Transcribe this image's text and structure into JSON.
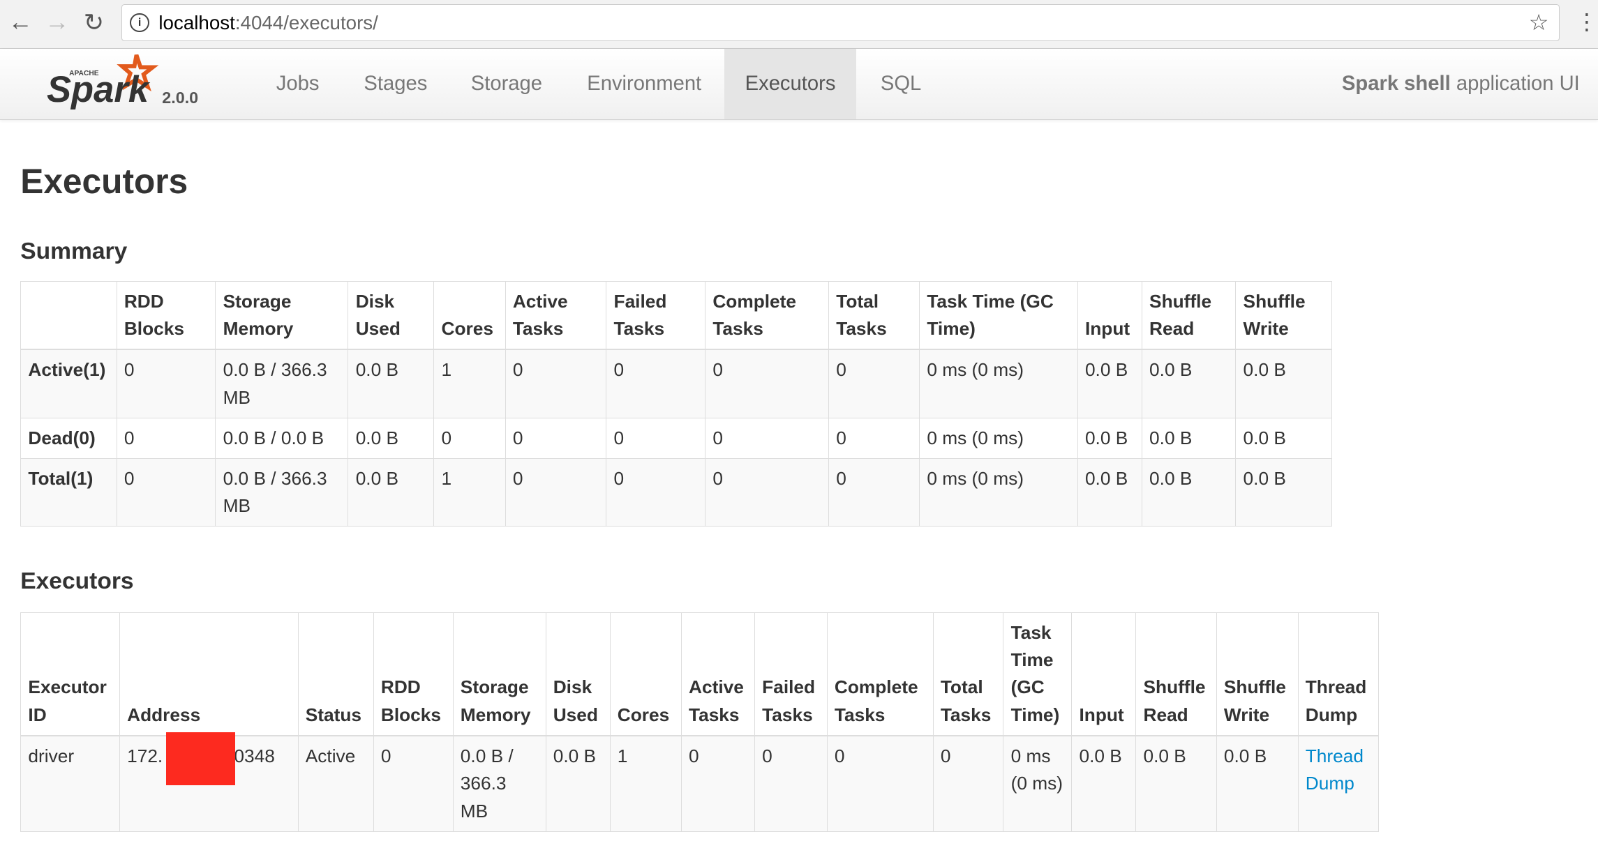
{
  "browser": {
    "url_host": "localhost",
    "url_rest": ":4044/executors/"
  },
  "nav": {
    "version": "2.0.0",
    "tabs": [
      "Jobs",
      "Stages",
      "Storage",
      "Environment",
      "Executors",
      "SQL"
    ],
    "active_tab": "Executors",
    "app_name_bold": "Spark shell",
    "app_name_rest": " application UI",
    "logo_text": "Spark",
    "logo_small": "APACHE"
  },
  "page": {
    "title": "Executors",
    "summary_heading": "Summary",
    "executors_heading": "Executors"
  },
  "summary": {
    "headers": [
      "",
      "RDD Blocks",
      "Storage Memory",
      "Disk Used",
      "Cores",
      "Active Tasks",
      "Failed Tasks",
      "Complete Tasks",
      "Total Tasks",
      "Task Time (GC Time)",
      "Input",
      "Shuffle Read",
      "Shuffle Write"
    ],
    "rows": [
      [
        "Active(1)",
        "0",
        "0.0 B / 366.3 MB",
        "0.0 B",
        "1",
        "0",
        "0",
        "0",
        "0",
        "0 ms (0 ms)",
        "0.0 B",
        "0.0 B",
        "0.0 B"
      ],
      [
        "Dead(0)",
        "0",
        "0.0 B / 0.0 B",
        "0.0 B",
        "0",
        "0",
        "0",
        "0",
        "0",
        "0 ms (0 ms)",
        "0.0 B",
        "0.0 B",
        "0.0 B"
      ],
      [
        "Total(1)",
        "0",
        "0.0 B / 366.3 MB",
        "0.0 B",
        "1",
        "0",
        "0",
        "0",
        "0",
        "0 ms (0 ms)",
        "0.0 B",
        "0.0 B",
        "0.0 B"
      ]
    ]
  },
  "executors": {
    "headers": [
      "Executor ID",
      "Address",
      "Status",
      "RDD Blocks",
      "Storage Memory",
      "Disk Used",
      "Cores",
      "Active Tasks",
      "Failed Tasks",
      "Complete Tasks",
      "Total Tasks",
      "Task Time (GC Time)",
      "Input",
      "Shuffle Read",
      "Shuffle Write",
      "Thread Dump"
    ],
    "rows": [
      [
        "driver",
        "172.            50348",
        "Active",
        "0",
        "0.0 B / 366.3 MB",
        "0.0 B",
        "1",
        "0",
        "0",
        "0",
        "0",
        "0 ms (0 ms)",
        "0.0 B",
        "0.0 B",
        "0.0 B",
        "Thread Dump"
      ]
    ]
  },
  "colors": {
    "link": "#0088cc",
    "redaction": "#fd2a1f",
    "logo_star": "#e25a1c"
  }
}
